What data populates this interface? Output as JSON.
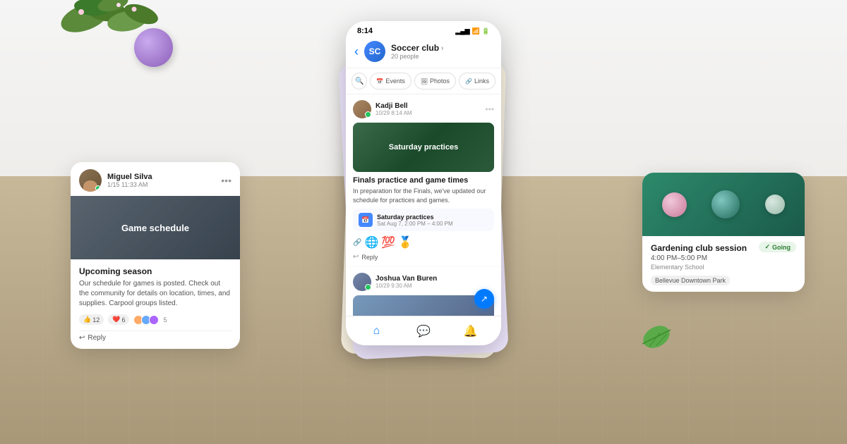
{
  "background": {
    "wall_color": "#f2f0ed",
    "table_color": "#c4b49a"
  },
  "decorative": {
    "purple_ball": true,
    "leaf_bottom_right": true,
    "plant_top_left": true
  },
  "left_card": {
    "user": "Miguel Silva",
    "timestamp": "1/15 11:33 AM",
    "image_label": "Game schedule",
    "title": "Upcoming season",
    "description": "Our schedule for games is posted. Check out the community for details on location, times, and supplies. Carpool groups listed.",
    "reactions": {
      "thumbs": "12",
      "heart": "6",
      "count": "5"
    },
    "reply_label": "Reply"
  },
  "phone": {
    "status_bar": {
      "time": "8:14",
      "signal": "▂▄▆",
      "wifi": "WiFi",
      "battery": "Bat"
    },
    "header": {
      "group_name": "Soccer club",
      "members_count": "20 people",
      "back_label": "‹"
    },
    "tabs": [
      {
        "label": "Events",
        "icon": "📅",
        "active": false
      },
      {
        "label": "Photos",
        "icon": "🖼",
        "active": false
      },
      {
        "label": "Links",
        "icon": "🔗",
        "active": false
      }
    ],
    "messages": [
      {
        "id": "msg1",
        "user": "Kadji Bell",
        "timestamp": "10/29 8:14 AM",
        "image_label": "Saturday practices",
        "post_title": "Finals practice and game times",
        "post_body": "In preparation for the Finals, we've updated our schedule for practices and games.",
        "event_name": "Saturday practices",
        "event_time": "Sat Aug 7, 2:00 PM – 4:00 PM",
        "emojis": [
          "🌐",
          "💯",
          "🥇"
        ],
        "reply_label": "Reply"
      },
      {
        "id": "msg2",
        "user": "Joshua Van Buren",
        "timestamp": "10/29 9:30 AM"
      }
    ],
    "nav": [
      {
        "icon": "🏠",
        "active": true,
        "label": "Home"
      },
      {
        "icon": "💬",
        "active": false,
        "label": "Messages"
      },
      {
        "icon": "🔔",
        "active": false,
        "label": "Notifications"
      }
    ],
    "fab_icon": "↗"
  },
  "right_card": {
    "title": "Gardening club session",
    "time": "4:00 PM–5:00 PM",
    "location_primary": "Elementary School",
    "location_secondary": "Bellevue Downtown Park",
    "going_label": "Going",
    "going_icon": "✓"
  },
  "stack_cards": {
    "color1": "#e8e0f8",
    "color2": "#fff5e0"
  }
}
